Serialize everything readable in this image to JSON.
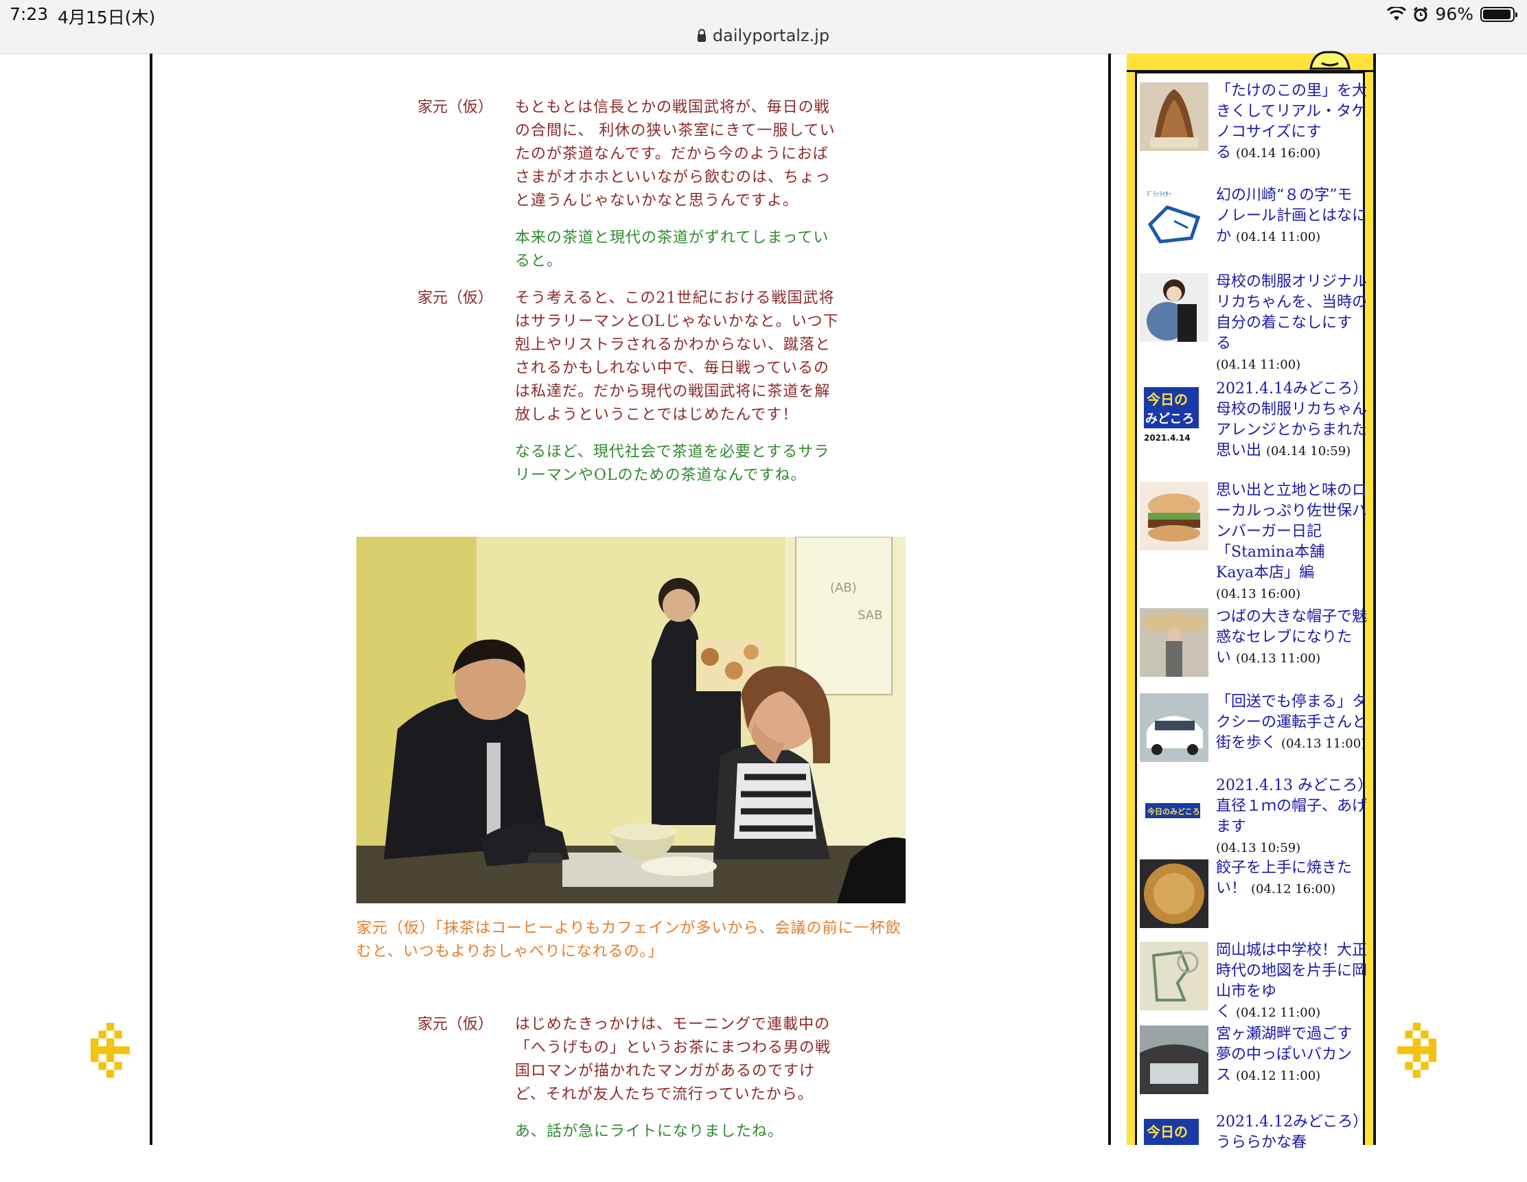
{
  "status_bar": {
    "time": "7:23",
    "date": "4月15日(木)",
    "battery": "96%",
    "battery_level": 0.96,
    "url": "dailyportalz.jp"
  },
  "article": {
    "blocks": [
      {
        "speaker": "家元（仮）",
        "text": "もともとは信長とかの戦国武将が、毎日の戦の合間に、 利休の狭い茶室にきて一服していたのが茶道なんです。だから今のようにおばさまがオホホといいながら飲むのは、ちょっと違うんじゃないかなと思うんですよ。"
      },
      {
        "reply": "本来の茶道と現代の茶道がずれてしまっていると。"
      },
      {
        "speaker": "家元（仮）",
        "text": "そう考えると、この21世紀における戦国武将はサラリーマンとOLじゃないかなと。いつ下剋上やリストラされるかわからない、蹴落とされるかもしれない中で、毎日戦っているのは私達だ。だから現代の戦国武将に茶道を解放しようということではじめたんです！"
      },
      {
        "reply": "なるほど、現代社会で茶道を必要とするサラリーマンやOLのための茶道なんですね。"
      },
      {
        "caption": "家元（仮）「抹茶はコーヒーよりもカフェインが多いから、会議の前に一杯飲むと、いつもよりおしゃべりになれるの。」"
      },
      {
        "speaker": "家元（仮）",
        "text": "はじめたきっかけは、モーニングで連載中の「へうげもの」というお茶にまつわる男の戦国ロマンが描かれたマンガがあるのですけど、それが友人たちで流行っていたから。"
      },
      {
        "reply": "あ、話が急にライトになりましたね。"
      }
    ]
  },
  "photo_sign": {
    "a": "(AB)",
    "b": "SAB"
  },
  "sidebar": {
    "items": [
      {
        "title": "「たけのこの里」を大きくしてリアル・タケノコサイズにする",
        "date": "(04.14 16:00)"
      },
      {
        "title": "幻の川崎“８の字”モノレール計画とはなにか",
        "date": "(04.14 11:00)"
      },
      {
        "title": "母校の制服オリジナルリカちゃんを、当時の自分の着こなしにする",
        "date": "(04.14 11:00)"
      },
      {
        "title": "2021.4.14みどころ）母校の制服リカちゃんアレンジとからまれた思い出",
        "date": "(04.14 10:59)"
      },
      {
        "title": "思い出と立地と味のローカルっぷり佐世保ハンバーガー日記「Stamina本舗 Kaya本店」編",
        "date": "(04.13 16:00)"
      },
      {
        "title": "つばの大きな帽子で魅惑なセレブになりたい",
        "date": "(04.13 11:00)"
      },
      {
        "title": "「回送でも停まる」タクシーの運転手さんと街を歩く",
        "date": "(04.13 11:00)"
      },
      {
        "title": "2021.4.13 みどころ）直径１ｍの帽子、あげます",
        "date": "(04.13 10:59)"
      },
      {
        "title": "餃子を上手に焼きたい！",
        "date": "(04.12 16:00)"
      },
      {
        "title": "岡山城は中学校！大正時代の地図を片手に岡山市をゆく",
        "date": "(04.12 11:00)"
      },
      {
        "title": "宮ヶ瀬湖畔で過ごす夢の中っぽいバカンス",
        "date": "(04.12 11:00)"
      },
      {
        "title": "2021.4.12みどころ）うららかな春",
        "date": ""
      }
    ],
    "thumb_labels": {
      "monorail": "ﾃﾞﾗﾝﾗｲﾀｰ",
      "today_a": "今日の",
      "today_b": "みどころ",
      "today_date": "2021.4.14",
      "today_small": "今日のみどころ"
    }
  },
  "colors": {
    "speech": "#8b2a2a",
    "reply": "#2f8a2f",
    "caption": "#e67c28",
    "link": "#1a1aa8",
    "sidebar_accent": "#ffe33a"
  }
}
